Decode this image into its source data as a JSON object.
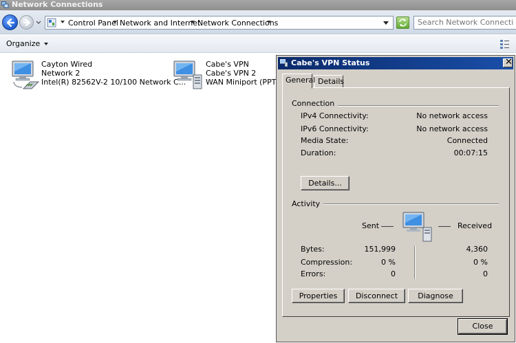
{
  "window": {
    "title": "Network Connections"
  },
  "address": {
    "crumbs": [
      "Control Panel",
      "Network and Internet",
      "Network Connections"
    ]
  },
  "search": {
    "placeholder": "Search Network Connections"
  },
  "toolbar": {
    "organize_label": "Organize"
  },
  "connections": [
    {
      "name": "Cayton Wired",
      "network": "Network  2",
      "device": "Intel(R) 82562V-2 10/100 Network C...",
      "icon": "wired-adapter-icon"
    },
    {
      "name": "Cabe's VPN",
      "network": "Cabe's VPN  2",
      "device": "WAN Miniport (PPTP)",
      "icon": "vpn-adapter-icon"
    }
  ],
  "dialog": {
    "title": "Cabe's VPN Status",
    "tabs": [
      "General",
      "Details"
    ],
    "connection_group": "Connection",
    "connection": [
      {
        "label": "IPv4 Connectivity:",
        "value": "No network access"
      },
      {
        "label": "IPv6 Connectivity:",
        "value": "No network access"
      },
      {
        "label": "Media State:",
        "value": "Connected"
      },
      {
        "label": "Duration:",
        "value": "00:07:15"
      }
    ],
    "details_button": "Details...",
    "activity_group": "Activity",
    "sent_label": "Sent",
    "received_label": "Received",
    "activity": [
      {
        "label": "Bytes:",
        "sent": "151,999",
        "received": "4,360"
      },
      {
        "label": "Compression:",
        "sent": "0 %",
        "received": "0 %"
      },
      {
        "label": "Errors:",
        "sent": "0",
        "received": "0"
      }
    ],
    "buttons": {
      "properties": "Properties",
      "disconnect": "Disconnect",
      "diagnose": "Diagnose",
      "close": "Close"
    }
  },
  "colors": {
    "title_bar": "#0b2a6b",
    "dialog_bg": "#d4d0c8",
    "explorer_title": "#9a9a9a"
  }
}
